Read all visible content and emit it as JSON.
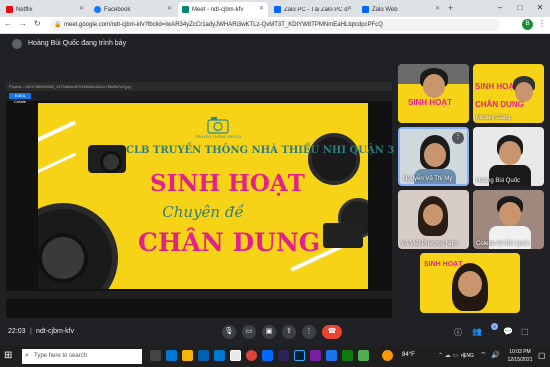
{
  "browser": {
    "tabs": [
      {
        "label": "Netflix",
        "color": "#e50914"
      },
      {
        "label": "Facebook",
        "color": "#1877f2"
      },
      {
        "label": "Meet - ndt-cjbm-kfv",
        "color": "#00897b"
      },
      {
        "label": "Zalo PC - Tải Zalo PC để liên...",
        "color": "#0068ff"
      },
      {
        "label": "Zalo Web",
        "color": "#0068ff"
      }
    ],
    "url": "meet.google.com/ndt-cjbm-kfv?fbclid=IwAR34yZcCr1adyJWHARi3wKTLz-QvMT3T_KDtYW8TPMNmEaHLtqtcdpcPFcQ",
    "profile_initial": "B"
  },
  "meet": {
    "presenter_text": "Hoàng Bùi Quốc đang trình bày",
    "shared_window_title": "Photos - z301798820088_1379d8de4f701b948c42d1c7f5e8b7c9.jpg",
    "shared_toolbar_btn": "Edit & Create",
    "slide": {
      "logo_text": "TRUYỀN THÔNG NHÍ Q3",
      "club_title": "CLB TRUYỀN THÔNG NHÀ THIẾU NHI QUẬN 3",
      "line1": "SINH HOẠT",
      "line2": "Chuyên đề",
      "line3": "CHÂN DUNG"
    },
    "participants": [
      {
        "name": ""
      },
      {
        "name": "Mickey Dang"
      },
      {
        "name": "Nguyễn Võ Thị My"
      },
      {
        "name": "Hoàng Bùi Quốc"
      },
      {
        "name": "Võ Viết Phương Nghi"
      },
      {
        "name": "Colette A2 Bùi Quốc"
      },
      {
        "name": ""
      }
    ],
    "controls": {
      "time": "22:03",
      "separator": "|",
      "meeting_code": "ndt-cjbm-kfv",
      "badge_count": "9"
    }
  },
  "taskbar": {
    "search_placeholder": "Type here to search",
    "weather": "84°F",
    "language": "ENG",
    "time": "10:03 PM",
    "date": "12/15/2021"
  }
}
